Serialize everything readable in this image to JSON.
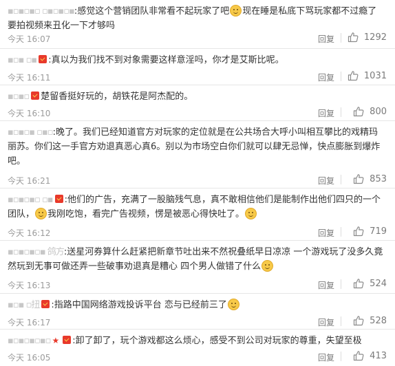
{
  "comments": [
    {
      "user": "▪▫▪▫▪▫ ▫▪▫▪▫▪",
      "text_before": ":感觉这个营销团队非常看不起玩家了吧",
      "text_after": "现在睡是私底下骂玩家都不过瘾了要拍视频来丑化一下才够吗",
      "time": "今天 16:07",
      "reply": "回复",
      "likes": "1292"
    },
    {
      "user": "▪▫▪ ▫▪",
      "text_before": ":真以为我们找不到对象需要这样意淫吗，你才是艾斯比呢。",
      "text_after": "",
      "time": "今天 16:11",
      "reply": "回复",
      "likes": "1031"
    },
    {
      "user": "▪▫▪▫",
      "text_before": "楚留香挺好玩的，胡铁花是阿杰配的。",
      "text_after": "",
      "time": "今天 16:10",
      "reply": "回复",
      "likes": "800"
    },
    {
      "user": "▪▫▪▫▪ ▫▪▫",
      "text_before": ":晚了。我们已经知道官方对玩家的定位就是在公共场合大呼小叫相互攀比的戏精玛丽苏。你们这一手官方劝退真恶心真6。别以为市场空白你们就可以肆无忌惮，快点膨胀到爆炸吧。",
      "text_after": "",
      "time": "今天 16:21",
      "reply": "回复",
      "likes": "853"
    },
    {
      "user": "▪▫▪▫▪▫ ▫▪",
      "text_before": ":他们的广告，充满了一股脑残气息，真不敢相信他们是能制作出他们四只的一个团队，",
      "text_middle": "我刚吃饱，看完广告视频，愣是被恶心得快吐了。",
      "text_after": "",
      "time": "今天 16:12",
      "reply": "回复",
      "likes": "719"
    },
    {
      "user": "▪▫▪▫▪▫▪ 鸽方",
      "text_before": ":送星河券算什么赶紧把新章节吐出来不然祝叠纸早日凉凉 一个游戏玩了没多久竟然玩到无事可做还弄一些破事劝退真是糟心 四个男人做错了什么",
      "text_after": "",
      "time": "今天 16:13",
      "reply": "回复",
      "likes": "524"
    },
    {
      "user": "▪▫▪ ▫扭",
      "text_before": ":指路中国网络游戏投诉平台 恋与已经前三了",
      "text_after": "",
      "time": "今天 16:17",
      "reply": "回复",
      "likes": "528"
    },
    {
      "user": "▪▫▪▫▪▫▪▫",
      "text_before": ":卸了卸了，玩个游戏都这么烦心，感受不到公司对玩家的尊重，失望至极",
      "text_after": "",
      "time": "今天 16:05",
      "reply": "回复",
      "likes": "413"
    }
  ]
}
